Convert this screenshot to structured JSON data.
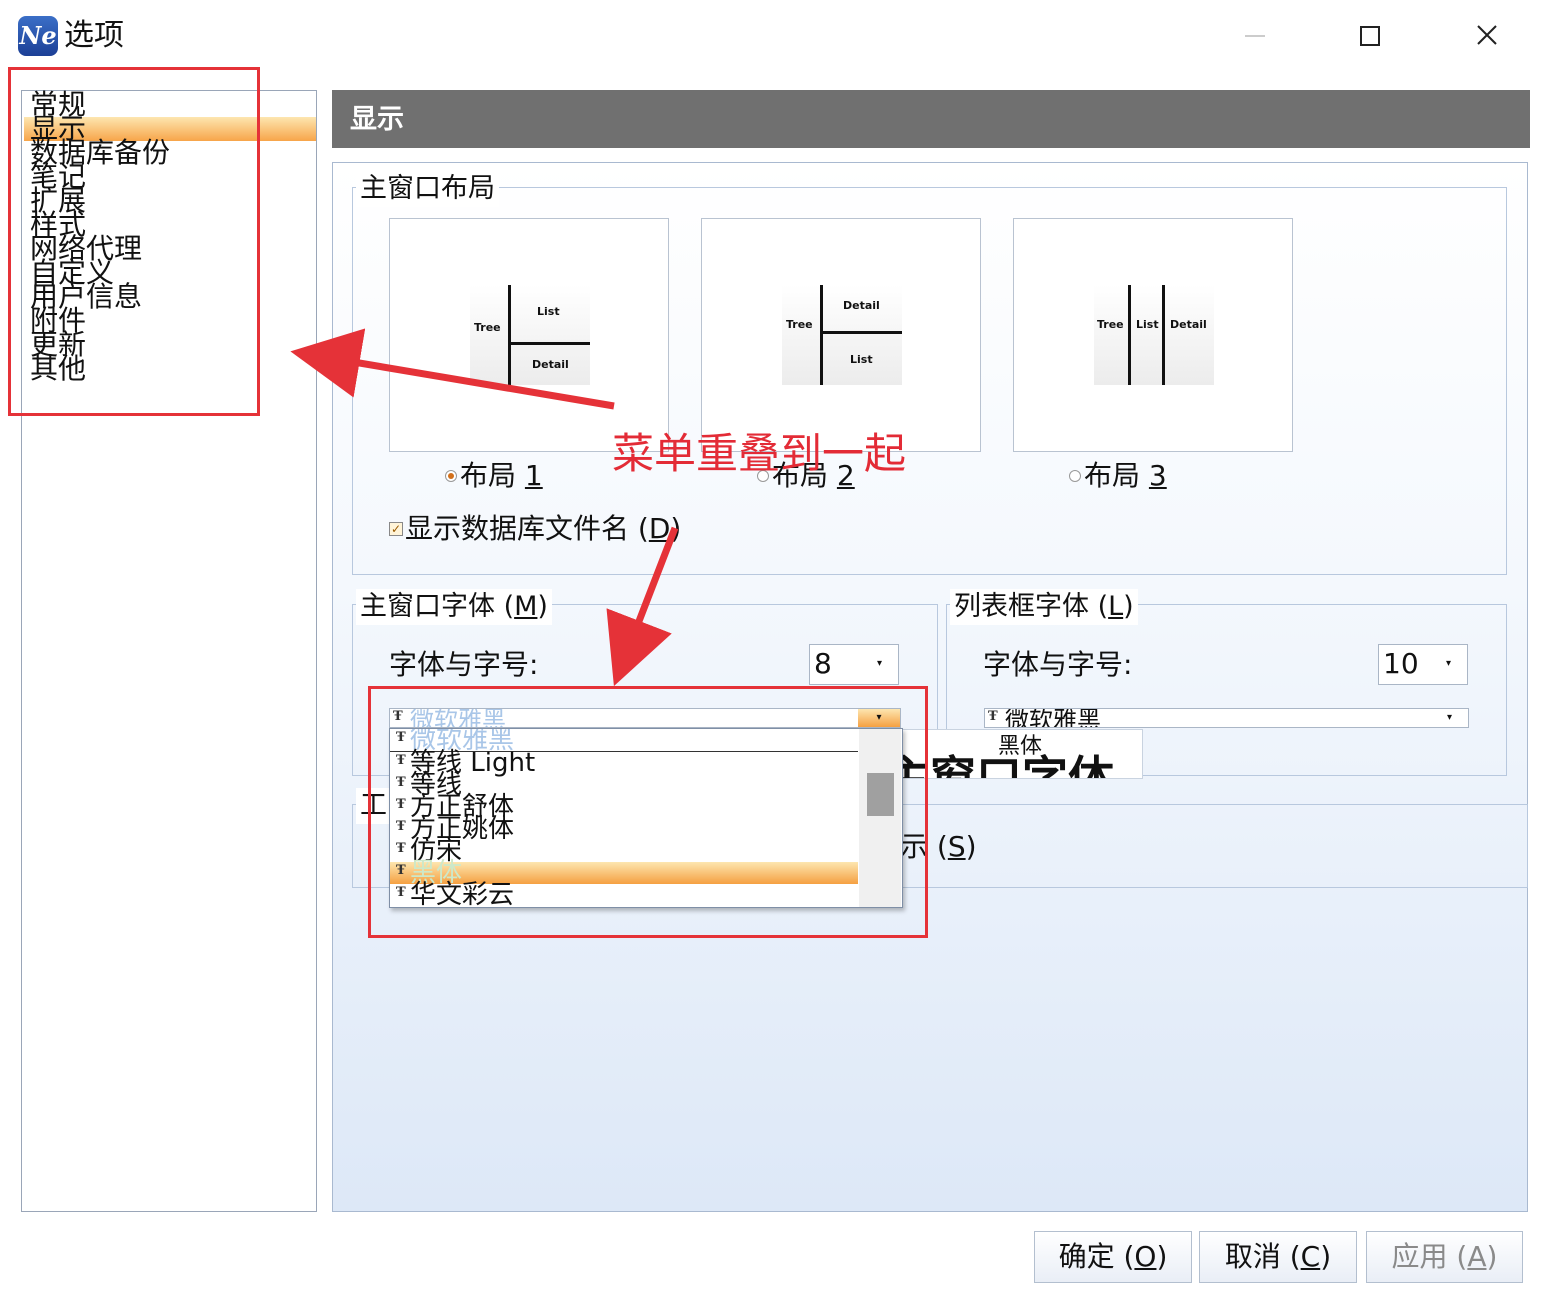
{
  "window": {
    "title": "选项",
    "app_icon": "Ne",
    "controls": [
      "minimize-icon",
      "maximize-icon",
      "close-icon"
    ]
  },
  "nav": {
    "items": [
      {
        "label": "常规"
      },
      {
        "label": "显示",
        "selected": true
      },
      {
        "label": "数据库备份"
      },
      {
        "label": "笔记"
      },
      {
        "label": "扩展"
      },
      {
        "label": "样式"
      },
      {
        "label": "网络代理"
      },
      {
        "label": "自定义"
      },
      {
        "label": "用户信息"
      },
      {
        "label": "附件"
      },
      {
        "label": "更新"
      },
      {
        "label": "其他"
      }
    ]
  },
  "header": {
    "title": "显示"
  },
  "layout_group": {
    "title": "主窗口布局",
    "options": [
      {
        "label": "布局 ",
        "key": "1",
        "selected": true,
        "thumb": {
          "tree": "Tree",
          "list": "List",
          "detail": "Detail"
        }
      },
      {
        "label": "布局 ",
        "key": "2",
        "selected": false,
        "thumb": {
          "tree": "Tree",
          "list": "List",
          "detail": "Detail"
        }
      },
      {
        "label": "布局 ",
        "key": "3",
        "selected": false,
        "thumb": {
          "tree": "Tree",
          "list": "List",
          "detail": "Detail"
        }
      }
    ],
    "show_db_filename": {
      "label": "显示数据库文件名 (",
      "key": "D",
      "suffix": ")",
      "checked": true
    }
  },
  "main_font_group": {
    "title": "主窗口字体 (",
    "title_key": "M",
    "title_suffix": ")",
    "font_size_label": "字体与字号:",
    "font_size_value": "8",
    "font_name_value": "微软雅黑",
    "dropdown_items": [
      "微软雅黑",
      "等线 Light",
      "等线",
      "方正舒体",
      "方正姚体",
      "仿宋",
      "黑体",
      "华文彩云"
    ],
    "dropdown_selected": "黑体"
  },
  "list_font_group": {
    "title": "列表框字体 (",
    "title_key": "L",
    "title_suffix": ")",
    "font_size_label": "字体与字号:",
    "font_size_value": "10",
    "font_name_value": "微软雅黑",
    "tooltip_text": "黑体",
    "preview_fragment": "主窗口字体"
  },
  "toolbar_group": {
    "title_fragment": "工",
    "option_fragment": "示 (",
    "option_key": "S",
    "option_suffix": ")"
  },
  "buttons": {
    "ok": {
      "label": "确定 (",
      "key": "O",
      "suffix": ")"
    },
    "cancel": {
      "label": "取消 (",
      "key": "C",
      "suffix": ")"
    },
    "apply": {
      "label": "应用 (",
      "key": "A",
      "suffix": ")",
      "disabled": true
    }
  },
  "annotation": {
    "text": "菜单重叠到一起",
    "color": "#e32b36"
  }
}
